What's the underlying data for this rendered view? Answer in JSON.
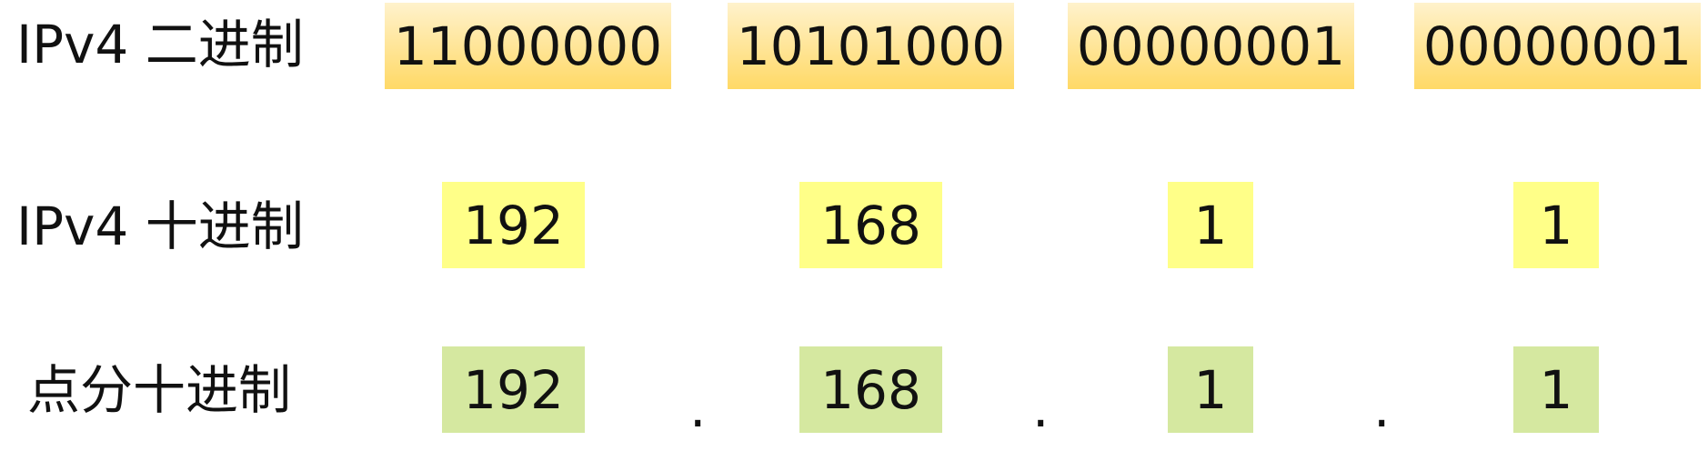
{
  "rows": {
    "binary": {
      "label": "IPv4 二进制",
      "octets": [
        "11000000",
        "10101000",
        "00000001",
        "00000001"
      ]
    },
    "decimal": {
      "label": "IPv4 十进制",
      "octets": [
        "192",
        "168",
        "1",
        "1"
      ]
    },
    "dotted": {
      "label": "点分十进制",
      "octets": [
        "192",
        "168",
        "1",
        "1"
      ],
      "separator": "."
    }
  },
  "colors": {
    "binary_gradient_top": "#fff2cc",
    "binary_gradient_bottom": "#ffd966",
    "decimal_fill": "#ffff88",
    "dotted_fill": "#d5e8a0"
  }
}
